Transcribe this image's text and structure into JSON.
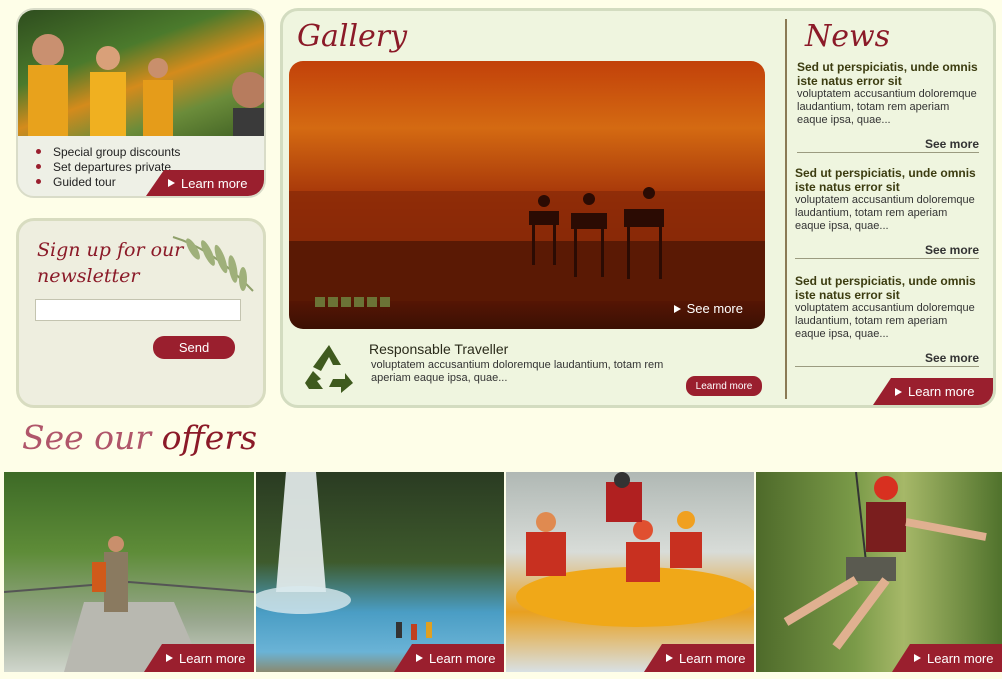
{
  "promo": {
    "bullets": [
      "Special group discounts",
      "Set departures private",
      "Guided tour"
    ],
    "learn_more": "Learn more"
  },
  "newsletter": {
    "title_line1": "Sign up for our",
    "title_line2": "newsletter",
    "email_value": "",
    "send": "Send"
  },
  "gallery": {
    "title": "Gallery",
    "see_more": "See more",
    "dots": 6
  },
  "traveller": {
    "title": "Responsable Traveller",
    "body": "voluptatem accusantium doloremque laudantium, totam rem aperiam eaque ipsa, quae...",
    "button": "Learnd more"
  },
  "news": {
    "title": "News",
    "items": [
      {
        "title": "Sed ut perspiciatis, unde omnis iste natus error sit",
        "body": "voluptatem accusantium doloremque laudantium, totam rem aperiam eaque ipsa, quae...",
        "more": "See more"
      },
      {
        "title": "Sed ut perspiciatis, unde omnis iste natus error sit",
        "body": "voluptatem accusantium doloremque laudantium, totam rem aperiam eaque ipsa, quae...",
        "more": "See more"
      },
      {
        "title": "Sed ut perspiciatis, unde omnis iste natus error sit",
        "body": "voluptatem accusantium doloremque laudantium, totam rem aperiam eaque ipsa, quae...",
        "more": "See more"
      }
    ],
    "learn_more": "Learn more"
  },
  "offers": {
    "title_part1": "See our",
    "title_part2": "offers",
    "cards": [
      {
        "learn_more": "Learn more"
      },
      {
        "learn_more": "Learn more"
      },
      {
        "learn_more": "Learn more"
      },
      {
        "learn_more": "Learn more"
      }
    ]
  },
  "colors": {
    "accent": "#9a1f2e",
    "panel_bg": "#eff5df",
    "page_bg": "#fefee8"
  }
}
